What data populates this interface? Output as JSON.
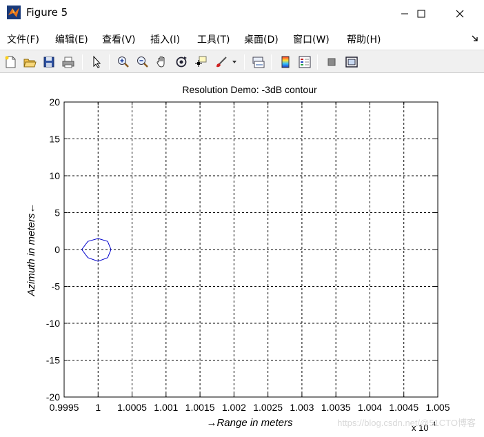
{
  "window": {
    "title": "Figure 5",
    "icon": "matlab-icon",
    "controls": [
      "minimize-icon",
      "maximize-icon",
      "close-icon"
    ]
  },
  "menu": {
    "items": [
      {
        "id": "file",
        "label": "文件(F)"
      },
      {
        "id": "edit",
        "label": "编辑(E)"
      },
      {
        "id": "view",
        "label": "查看(V)"
      },
      {
        "id": "insert",
        "label": "插入(I)"
      },
      {
        "id": "tools",
        "label": "工具(T)"
      },
      {
        "id": "desktop",
        "label": "桌面(D)"
      },
      {
        "id": "window",
        "label": "窗口(W)"
      },
      {
        "id": "help",
        "label": "帮助(H)"
      }
    ]
  },
  "toolbar": {
    "buttons": [
      "new-figure-icon",
      "open-file-icon",
      "save-icon",
      "print-icon",
      "edit-plot-arrow-icon",
      "zoom-in-icon",
      "zoom-out-icon",
      "pan-hand-icon",
      "rotate-3d-icon",
      "data-cursor-icon",
      "brush-icon",
      "link-plot-icon",
      "colorbar-icon",
      "legend-icon",
      "hide-plot-tools-icon",
      "show-plot-tools-icon"
    ]
  },
  "chart_data": {
    "type": "line",
    "title": "Resolution Demo: -3dB contour",
    "xlabel": "→Range in meters",
    "ylabel": "Azimuth in meters←",
    "x_exponent_label": "x 10",
    "x_exponent_power": "4",
    "xlim": [
      0.9995,
      1.005
    ],
    "ylim": [
      -20,
      20
    ],
    "xticks": [
      0.9995,
      1,
      1.0005,
      1.001,
      1.0015,
      1.002,
      1.0025,
      1.003,
      1.0035,
      1.004,
      1.0045,
      1.005
    ],
    "xtick_labels": [
      "0.9995",
      "1",
      "1.0005",
      "1.001",
      "1.0015",
      "1.002",
      "1.0025",
      "1.003",
      "1.0035",
      "1.004",
      "1.0045",
      "1.005"
    ],
    "yticks": [
      -20,
      -15,
      -10,
      -5,
      0,
      5,
      10,
      15,
      20
    ],
    "ytick_labels": [
      "-20",
      "-15",
      "-10",
      "-5",
      "0",
      "5",
      "10",
      "15",
      "20"
    ],
    "grid": true,
    "grid_style": "dashed",
    "series": [
      {
        "color": "#0000cc",
        "x": [
          0.99976,
          0.99985,
          1.0,
          1.00014,
          1.00019,
          1.00014,
          1.0,
          0.99985,
          0.99976
        ],
        "y": [
          0.0,
          1.1,
          1.5,
          1.1,
          0.0,
          -1.1,
          -1.6,
          -1.1,
          0.0
        ]
      }
    ]
  },
  "watermark": "https://blog.csdn.net/@51CTO博客"
}
